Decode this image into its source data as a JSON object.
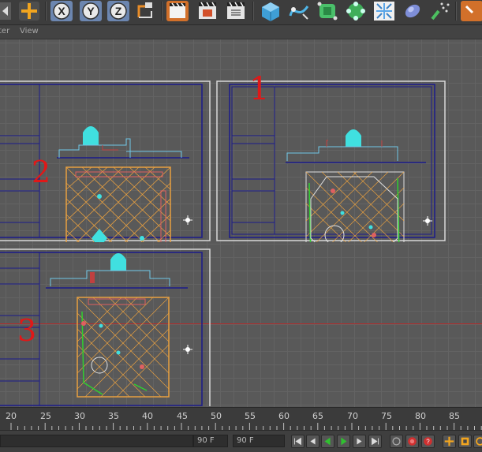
{
  "menubar": {
    "items": [
      "ter",
      "View"
    ]
  },
  "toolbar": {
    "buttons": [
      "undo-icon",
      "move-icon",
      "x-axis-icon",
      "y-axis-icon",
      "z-axis-icon",
      "coordinate-system-icon",
      "render-view-icon",
      "render-active-icon",
      "render-settings-icon",
      "cube-icon",
      "spline-pen-icon",
      "subdivision-icon",
      "array-icon",
      "deformer-icon",
      "environment-icon",
      "scene-icon",
      "light-icon"
    ],
    "axis_labels": {
      "x": "X",
      "y": "Y",
      "z": "Z"
    }
  },
  "viewport": {
    "markers": {
      "one": "1",
      "two": "2",
      "three": "3"
    }
  },
  "timeline": {
    "ticks": [
      "20",
      "25",
      "30",
      "35",
      "40",
      "45",
      "50",
      "55",
      "60",
      "65",
      "70",
      "75",
      "80",
      "85"
    ]
  },
  "transport": {
    "end_frame_left": "90 F",
    "end_frame_right": "90 F"
  },
  "colors": {
    "marker_red": "#e01818",
    "frame_navy": "#1a1a8a",
    "floor_orange": "#e8a040",
    "cyan": "#40e0e0",
    "green": "#30d030",
    "play_green": "#30c030"
  }
}
